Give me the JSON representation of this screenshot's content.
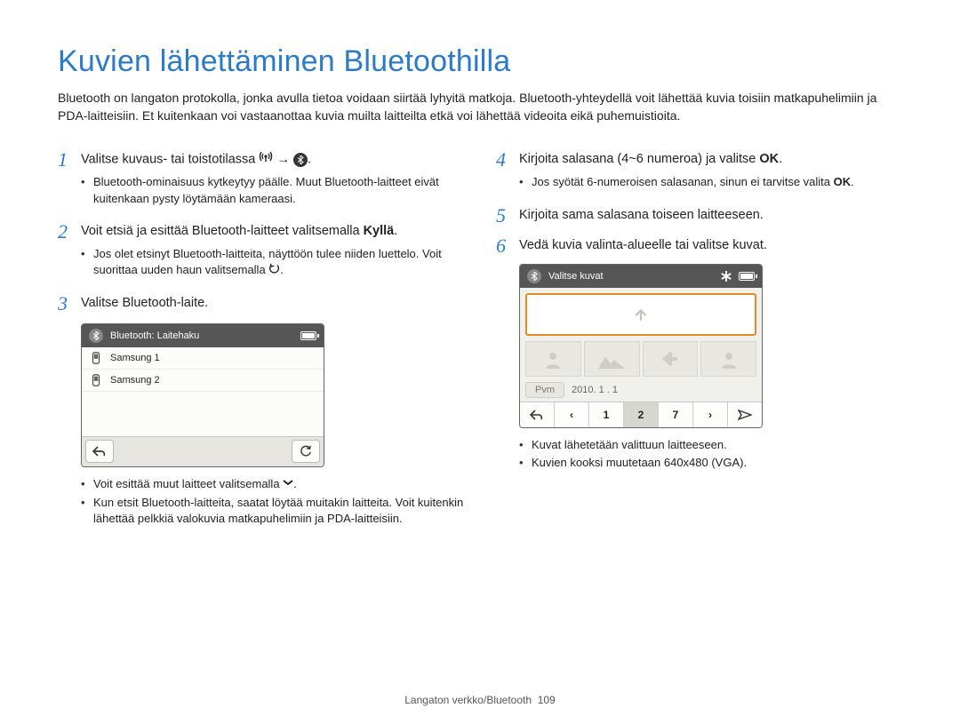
{
  "page": {
    "title": "Kuvien lähettäminen Bluetoothilla",
    "intro": "Bluetooth on langaton protokolla, jonka avulla tietoa voidaan siirtää lyhyitä matkoja. Bluetooth-yhteydellä voit lähettää kuvia toisiin matkapuhelimiin ja PDA-laitteisiin. Et kuitenkaan voi vastaanottaa kuvia muilta laitteilta etkä voi lähettää videoita eikä puhemuistioita.",
    "footer_label": "Langaton verkko/Bluetooth",
    "footer_page": "109"
  },
  "left": {
    "step1_pre": "Valitse kuvaus- tai toistotilassa ",
    "step1_post": ".",
    "step1_bullets": [
      "Bluetooth-ominaisuus kytkeytyy päälle. Muut Bluetooth-laitteet eivät kuitenkaan pysty löytämään kameraasi."
    ],
    "step2_pre": "Voit etsiä ja esittää Bluetooth-laitteet valitsemalla ",
    "step2_bold": "Kyllä",
    "step2_post": ".",
    "step2_bullets": [
      "Jos olet etsinyt Bluetooth-laitteita, näyttöön tulee niiden luettelo. Voit suorittaa uuden haun valitsemalla "
    ],
    "step3": "Valitse Bluetooth-laite.",
    "ui1": {
      "title": "Bluetooth: Laitehaku",
      "items": [
        "Samsung 1",
        "Samsung 2"
      ]
    },
    "after_ui1": [
      "Voit esittää muut laitteet valitsemalla ",
      "Kun etsit Bluetooth-laitteita, saatat löytää muitakin laitteita. Voit kuitenkin lähettää pelkkiä valokuvia matkapuhelimiin ja PDA-laitteisiin."
    ]
  },
  "right": {
    "step4_pre": "Kirjoita salasana (4~6 numeroa) ja valitse ",
    "step4_bold": "OK",
    "step4_post": ".",
    "step4_bullet_pre": "Jos syötät 6-numeroisen salasanan, sinun ei tarvitse valita ",
    "step4_bullet_bold": "OK",
    "step4_bullet_post": ".",
    "step5": "Kirjoita sama salasana toiseen laitteeseen.",
    "step6": "Vedä kuvia valinta-alueelle tai valitse kuvat.",
    "ui2": {
      "title": "Valitse kuvat",
      "date_label": "Pvm",
      "date_value": "2010. 1 . 1",
      "pages": [
        "1",
        "2",
        "7"
      ]
    },
    "after_ui2": [
      "Kuvat lähetetään valittuun laitteeseen.",
      "Kuvien kooksi muutetaan 640x480 (VGA)."
    ]
  },
  "nums": {
    "n1": "1",
    "n2": "2",
    "n3": "3",
    "n4": "4",
    "n5": "5",
    "n6": "6"
  }
}
